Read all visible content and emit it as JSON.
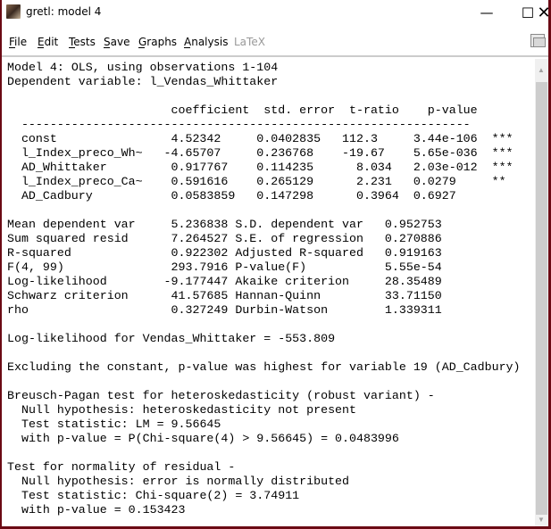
{
  "window": {
    "title": "gretl: model 4"
  },
  "menu": [
    "File",
    "Edit",
    "Tests",
    "Save",
    "Graphs",
    "Analysis",
    "LaTeX"
  ],
  "output": {
    "header": [
      "Model 4: OLS, using observations 1-104",
      "Dependent variable: l_Vendas_Whittaker"
    ],
    "columns": [
      "coefficient",
      "std. error",
      "t-ratio",
      "p-value"
    ],
    "dashes": "---------------------------------------------------------------",
    "rows": [
      {
        "name": "const",
        "coef": "4.52342",
        "se": "0.0402835",
        "t": "112.3",
        "p": "3.44e-106",
        "stars": "***"
      },
      {
        "name": "l_Index_preco_Wh~",
        "coef": "-4.65707",
        "se": "0.236768",
        "t": "-19.67",
        "p": "5.65e-036",
        "stars": "***"
      },
      {
        "name": "AD_Whittaker",
        "coef": "0.917767",
        "se": "0.114235",
        "t": "8.034",
        "p": "2.03e-012",
        "stars": "***"
      },
      {
        "name": "l_Index_preco_Ca~",
        "coef": "0.591616",
        "se": "0.265129",
        "t": "2.231",
        "p": "0.0279",
        "stars": "**"
      },
      {
        "name": "AD_Cadbury",
        "coef": "0.0583859",
        "se": "0.147298",
        "t": "0.3964",
        "p": "0.6927",
        "stars": ""
      }
    ],
    "stats": [
      {
        "l1": "Mean dependent var",
        "v1": "5.236838",
        "l2": "S.D. dependent var",
        "v2": "0.952753"
      },
      {
        "l1": "Sum squared resid",
        "v1": "7.264527",
        "l2": "S.E. of regression",
        "v2": "0.270886"
      },
      {
        "l1": "R-squared",
        "v1": "0.922302",
        "l2": "Adjusted R-squared",
        "v2": "0.919163"
      },
      {
        "l1": "F(4, 99)",
        "v1": "293.7916",
        "l2": "P-value(F)",
        "v2": "5.55e-54"
      },
      {
        "l1": "Log-likelihood",
        "v1": "-9.177447",
        "l2": "Akaike criterion",
        "v2": "28.35489"
      },
      {
        "l1": "Schwarz criterion",
        "v1": "41.57685",
        "l2": "Hannan-Quinn",
        "v2": "33.71150"
      },
      {
        "l1": "rho",
        "v1": "0.327249",
        "l2": "Durbin-Watson",
        "v2": "1.339311"
      }
    ],
    "loglik": "Log-likelihood for Vendas_Whittaker = -553.809",
    "excluding": "Excluding the constant, p-value was highest for variable 19 (AD_Cadbury)",
    "bp": [
      "Breusch-Pagan test for heteroskedasticity (robust variant) -",
      "  Null hypothesis: heteroskedasticity not present",
      "  Test statistic: LM = 9.56645",
      "  with p-value = P(Chi-square(4) > 9.56645) = 0.0483996"
    ],
    "normality": [
      "Test for normality of residual -",
      "  Null hypothesis: error is normally distributed",
      "  Test statistic: Chi-square(2) = 3.74911",
      "  with p-value = 0.153423"
    ]
  }
}
